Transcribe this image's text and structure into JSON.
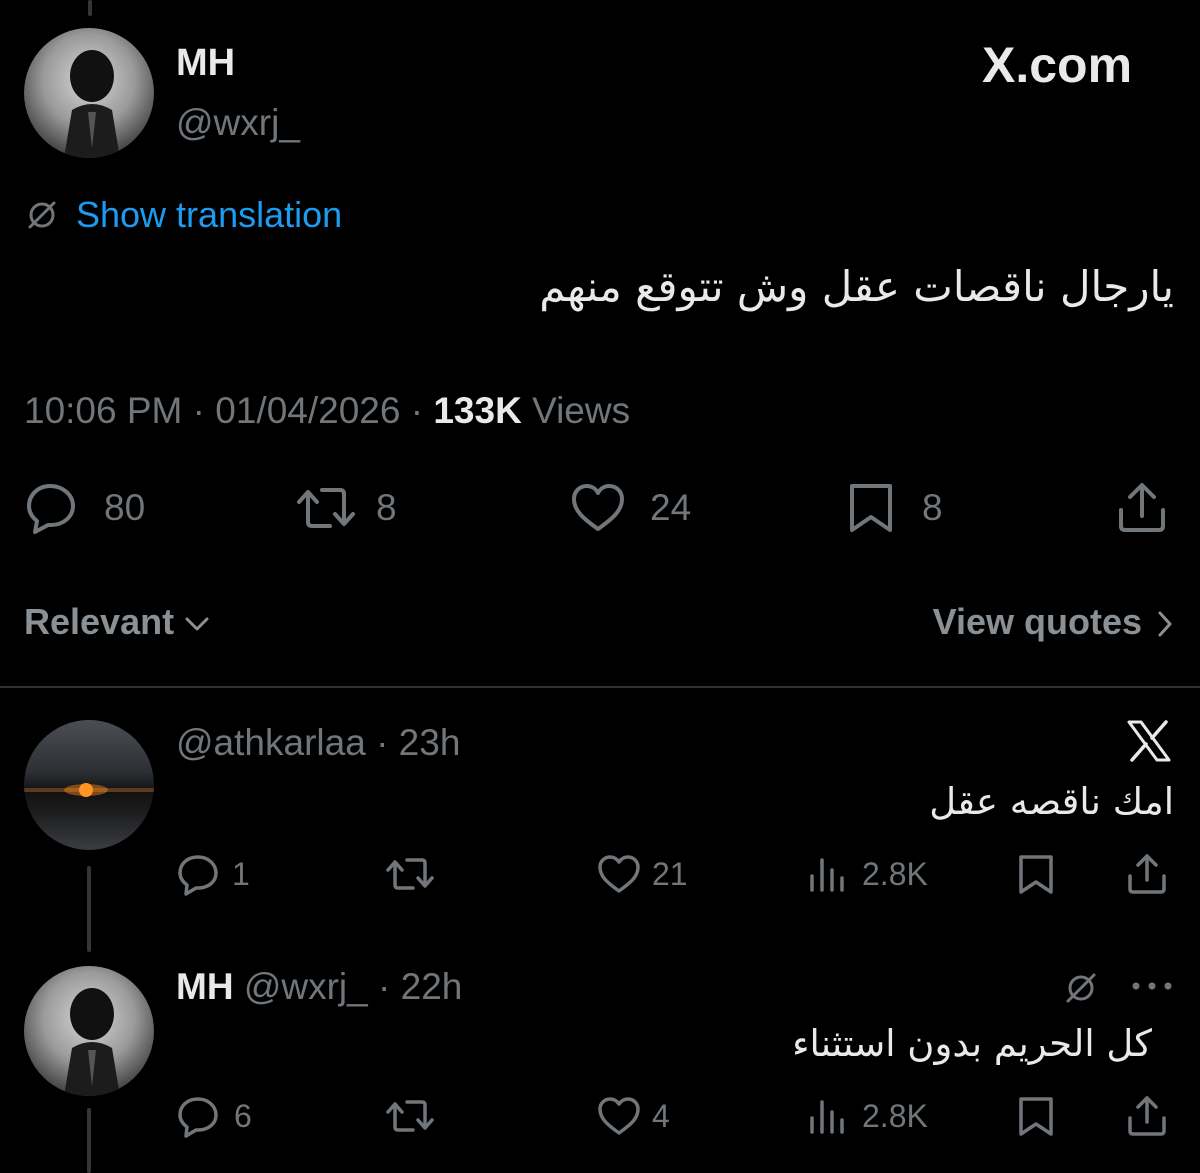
{
  "main_tweet": {
    "display_name": "MH",
    "handle": "@wxrj_",
    "brand": "X.com",
    "translate_label": "Show translation",
    "text": "يارجال ناقصات عقل وش تتوقع منهم",
    "time": "10:06 PM",
    "sep1": "·",
    "date": "01/04/2026",
    "sep2": "·",
    "views_count": "133K",
    "views_label": "Views",
    "actions": {
      "replies": "80",
      "reposts": "8",
      "likes": "24",
      "bookmarks": "8"
    }
  },
  "sort": {
    "label": "Relevant",
    "view_quotes": "View quotes"
  },
  "replies": [
    {
      "handle": "@athkarlaa",
      "sep": "·",
      "time": "23h",
      "text": "امك ناقصه عقل",
      "replies": "1",
      "likes": "21",
      "views": "2.8K"
    },
    {
      "display_name": "MH",
      "handle": "@wxrj_",
      "sep": "·",
      "time": "22h",
      "text": "كل الحريم بدون استثناء",
      "replies": "6",
      "likes": "4",
      "views": "2.8K"
    }
  ],
  "colors": {
    "background": "#000000",
    "text": "#e7e9ea",
    "muted": "#71767b",
    "link": "#1d9bf0",
    "divider": "#2f3336"
  },
  "icons": [
    "translate-icon",
    "reply-icon",
    "repost-icon",
    "like-icon",
    "bookmark-icon",
    "share-icon",
    "views-icon",
    "chevron-down-icon",
    "chevron-right-icon",
    "x-logo-icon",
    "more-icon"
  ]
}
